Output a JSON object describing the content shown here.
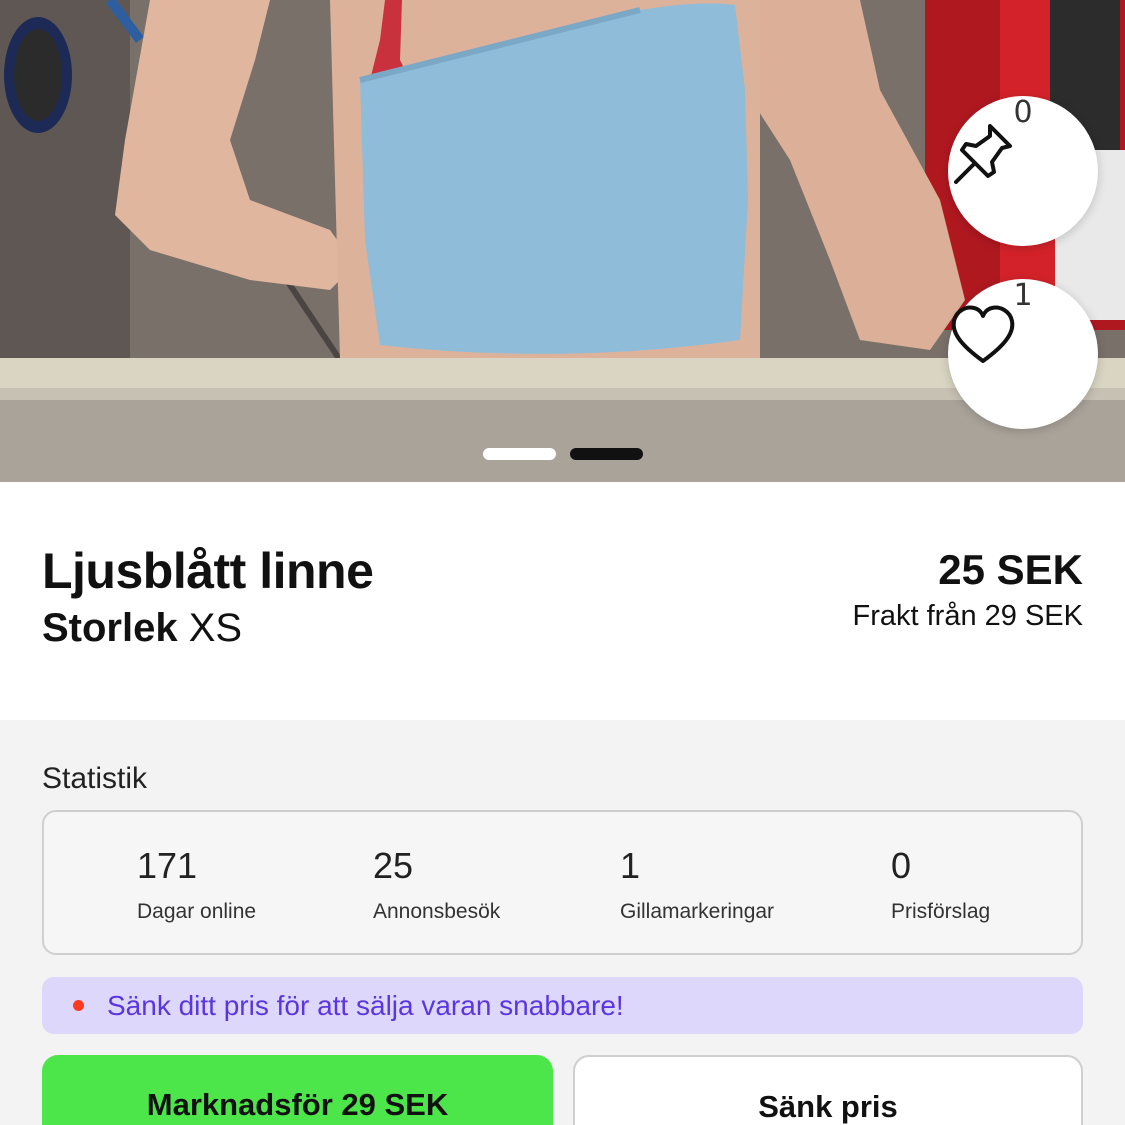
{
  "listing": {
    "title": "Ljusblått linne",
    "size_label": "Storlek",
    "size_value": "XS",
    "price": "25 SEK",
    "shipping": "Frakt från 29 SEK"
  },
  "photo": {
    "pin_count": "0",
    "like_count": "1",
    "carousel_pages": 2,
    "active_page": 1
  },
  "stats": {
    "heading": "Statistik",
    "items": [
      {
        "value": "171",
        "label": "Dagar online"
      },
      {
        "value": "25",
        "label": "Annonsbesök"
      },
      {
        "value": "1",
        "label": "Gillamarkeringar"
      },
      {
        "value": "0",
        "label": "Prisförslag"
      }
    ]
  },
  "tip": {
    "text": "Sänk ditt pris för att sälja varan snabbare!"
  },
  "actions": {
    "promote_label": "Marknadsför 29 SEK",
    "lower_price_label": "Sänk pris"
  },
  "colors": {
    "promote_green": "#4ce64a",
    "tip_background": "#dcd7fb",
    "tip_text": "#5b36e0",
    "tip_bullet": "#ff3b1f"
  }
}
